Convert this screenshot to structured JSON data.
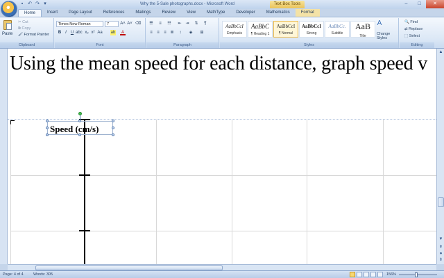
{
  "window": {
    "title": "Why the 5-Sale photographs.docx - Microsoft Word",
    "context_tab_title": "Text Box Tools"
  },
  "tabs": [
    {
      "label": "Home",
      "active": true
    },
    {
      "label": "Insert"
    },
    {
      "label": "Page Layout"
    },
    {
      "label": "References"
    },
    {
      "label": "Mailings"
    },
    {
      "label": "Review"
    },
    {
      "label": "View"
    },
    {
      "label": "MathType"
    },
    {
      "label": "Developer"
    },
    {
      "label": "Mathematics"
    },
    {
      "label": "Format",
      "contextual": true
    }
  ],
  "ribbon": {
    "clipboard": {
      "label": "Clipboard",
      "paste": "Paste",
      "cut": "Cut",
      "copy": "Copy",
      "format_painter": "Format Painter"
    },
    "font": {
      "label": "Font",
      "font_name": "Times New Roman",
      "font_size": "7"
    },
    "paragraph": {
      "label": "Paragraph"
    },
    "styles": {
      "label": "Styles",
      "tiles": [
        {
          "sample": "AaBbCcI",
          "name": "Emphasis"
        },
        {
          "sample": "AaBbC",
          "name": "¶ Heading 1"
        },
        {
          "sample": "AaBbCcI",
          "name": "¶ Normal",
          "selected": true
        },
        {
          "sample": "AaBbCcI",
          "name": "Strong"
        },
        {
          "sample": "AaBbCc.",
          "name": "Subtitle"
        },
        {
          "sample": "AaB",
          "name": "Title"
        }
      ],
      "change_styles": "Change Styles"
    },
    "editing": {
      "label": "Editing",
      "find": "Find",
      "replace": "Replace",
      "select": "Select"
    }
  },
  "document": {
    "heading": "Using the mean speed for each distance, graph speed v",
    "textbox_text": "Speed (cm/s)"
  },
  "status": {
    "page": "Page: 4 of 4",
    "words": "Words: 305",
    "zoom": "156%"
  }
}
